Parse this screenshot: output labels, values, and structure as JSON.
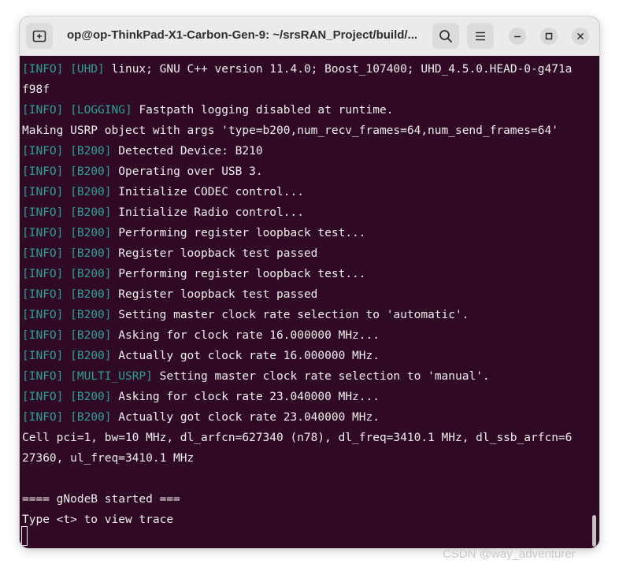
{
  "window": {
    "title": "op@op-ThinkPad-X1-Carbon-Gen-9: ~/srsRAN_Project/build/..."
  },
  "icons": {
    "new_tab": "new-tab-icon",
    "search": "search-icon",
    "menu": "hamburger-menu-icon",
    "minimize": "minimize-icon",
    "maximize": "maximize-icon",
    "close": "close-icon"
  },
  "colors": {
    "terminal_bg": "#300a24",
    "terminal_fg": "#eeeeec",
    "tag": "#2aa198",
    "titlebar_bg": "#ebebeb"
  },
  "terminal": {
    "lines": [
      {
        "level": "[INFO]",
        "source": "[UHD]",
        "text": "linux; GNU C++ version 11.4.0; Boost_107400; UHD_4.5.0.HEAD-0-g471a"
      },
      {
        "level": "",
        "source": "",
        "text": "f98f"
      },
      {
        "level": "[INFO]",
        "source": "[LOGGING]",
        "text": "Fastpath logging disabled at runtime."
      },
      {
        "level": "",
        "source": "",
        "text": "Making USRP object with args 'type=b200,num_recv_frames=64,num_send_frames=64'"
      },
      {
        "level": "[INFO]",
        "source": "[B200]",
        "text": "Detected Device: B210"
      },
      {
        "level": "[INFO]",
        "source": "[B200]",
        "text": "Operating over USB 3."
      },
      {
        "level": "[INFO]",
        "source": "[B200]",
        "text": "Initialize CODEC control..."
      },
      {
        "level": "[INFO]",
        "source": "[B200]",
        "text": "Initialize Radio control..."
      },
      {
        "level": "[INFO]",
        "source": "[B200]",
        "text": "Performing register loopback test..."
      },
      {
        "level": "[INFO]",
        "source": "[B200]",
        "text": "Register loopback test passed"
      },
      {
        "level": "[INFO]",
        "source": "[B200]",
        "text": "Performing register loopback test..."
      },
      {
        "level": "[INFO]",
        "source": "[B200]",
        "text": "Register loopback test passed"
      },
      {
        "level": "[INFO]",
        "source": "[B200]",
        "text": "Setting master clock rate selection to 'automatic'."
      },
      {
        "level": "[INFO]",
        "source": "[B200]",
        "text": "Asking for clock rate 16.000000 MHz..."
      },
      {
        "level": "[INFO]",
        "source": "[B200]",
        "text": "Actually got clock rate 16.000000 MHz."
      },
      {
        "level": "[INFO]",
        "source": "[MULTI_USRP]",
        "text": "Setting master clock rate selection to 'manual'."
      },
      {
        "level": "[INFO]",
        "source": "[B200]",
        "text": "Asking for clock rate 23.040000 MHz..."
      },
      {
        "level": "[INFO]",
        "source": "[B200]",
        "text": "Actually got clock rate 23.040000 MHz."
      },
      {
        "level": "",
        "source": "",
        "text": "Cell pci=1, bw=10 MHz, dl_arfcn=627340 (n78), dl_freq=3410.1 MHz, dl_ssb_arfcn=6"
      },
      {
        "level": "",
        "source": "",
        "text": "27360, ul_freq=3410.1 MHz"
      },
      {
        "level": "",
        "source": "",
        "text": ""
      },
      {
        "level": "",
        "source": "",
        "text": "==== gNodeB started ==="
      },
      {
        "level": "",
        "source": "",
        "text": "Type <t> to view trace"
      }
    ]
  },
  "watermark": "CSDN @way_adventurer"
}
